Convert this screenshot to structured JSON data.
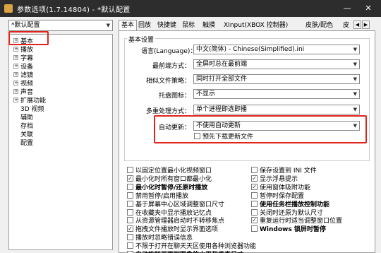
{
  "window": {
    "title": "参数选项(1.7.14804) - *默认配置",
    "controls": {
      "minimize": "—",
      "close": "✕"
    }
  },
  "preset": {
    "selected": "*默认配置"
  },
  "tree": [
    {
      "label": "基本",
      "expander": "+"
    },
    {
      "label": "播放",
      "expander": "+"
    },
    {
      "label": "字幕",
      "expander": "+"
    },
    {
      "label": "设备",
      "expander": "+"
    },
    {
      "label": "滤镜",
      "expander": "+"
    },
    {
      "label": "视频",
      "expander": "+"
    },
    {
      "label": "声音",
      "expander": "+"
    },
    {
      "label": "扩展功能",
      "expander": "+"
    },
    {
      "label": "3D 视频",
      "expander": ""
    },
    {
      "label": "辅助",
      "expander": ""
    },
    {
      "label": "存档",
      "expander": ""
    },
    {
      "label": "关联",
      "expander": ""
    },
    {
      "label": "配置",
      "expander": ""
    }
  ],
  "tabs": [
    "基本",
    "回放",
    "快捷键",
    "鼠标",
    "触摸",
    "XInput(XBOX 控制器)",
    "皮肤/配色",
    "皮"
  ],
  "tab_nav": {
    "left": "◀",
    "right": "▶"
  },
  "group_title": "基本设置",
  "settings": [
    {
      "label": "语言(Language)：",
      "value": "中文(简体) - Chinese(Simplified).ini"
    },
    {
      "label": "最前端方式：",
      "value": "全屏时总在最前端"
    },
    {
      "label": "相似文件策略：",
      "value": "同时打开全部文件"
    },
    {
      "label": "托盘图标：",
      "value": "不显示"
    },
    {
      "label": "多重处理方式：",
      "value": "单个进程即选即播"
    },
    {
      "label": "自动更新：",
      "value": "不使用自动更新"
    }
  ],
  "predownload": {
    "label": "预先下载更新文件",
    "checked": false
  },
  "options_left": [
    {
      "label": "以固定位置最小化视频窗口",
      "checked": false,
      "bold": false
    },
    {
      "label": "最小化时所有窗口都最小化",
      "checked": true,
      "bold": false
    },
    {
      "label": "最小化时暂停/还原时播放",
      "checked": false,
      "bold": true
    },
    {
      "label": "禁用暂停/启用播放",
      "checked": false,
      "bold": false
    },
    {
      "label": "基于屏幕中心区域调整窗口尺寸",
      "checked": false,
      "bold": false
    },
    {
      "label": "在收藏夹中显示播放记忆点",
      "checked": false,
      "bold": false
    },
    {
      "label": "从资源管理器启动时不转移焦点",
      "checked": false,
      "bold": false
    },
    {
      "label": "拖拽文件播放时显示界面选项",
      "checked": true,
      "bold": false
    },
    {
      "label": "播放时忽略错误信息",
      "checked": false,
      "bold": false
    },
    {
      "label": "不限于打开在聊天天区使用各种浏览器功能",
      "checked": false,
      "bold": false
    },
    {
      "label": "自动旋转画面到图像的水平和垂直尺寸",
      "checked": false,
      "bold": true
    }
  ],
  "options_right": [
    {
      "label": "保存设置到 INI 文件",
      "checked": false,
      "bold": false
    },
    {
      "label": "显示浮悬提示",
      "checked": true,
      "bold": false
    },
    {
      "label": "使用窗体吸附功能",
      "checked": true,
      "bold": false
    },
    {
      "label": "暂停时保存配置",
      "checked": false,
      "bold": false
    },
    {
      "label": "使用任务栏播放控制功能",
      "checked": false,
      "bold": true
    },
    {
      "label": "关闭时还原为默认尺寸",
      "checked": false,
      "bold": false
    },
    {
      "label": "重复运行时适当调整窗口位置",
      "checked": true,
      "bold": false
    },
    {
      "label": "Windows 锁屏时暂停",
      "checked": false,
      "bold": true
    }
  ],
  "colors": {
    "highlight": "#e2231a",
    "titlebar": "#2d2d2d"
  }
}
